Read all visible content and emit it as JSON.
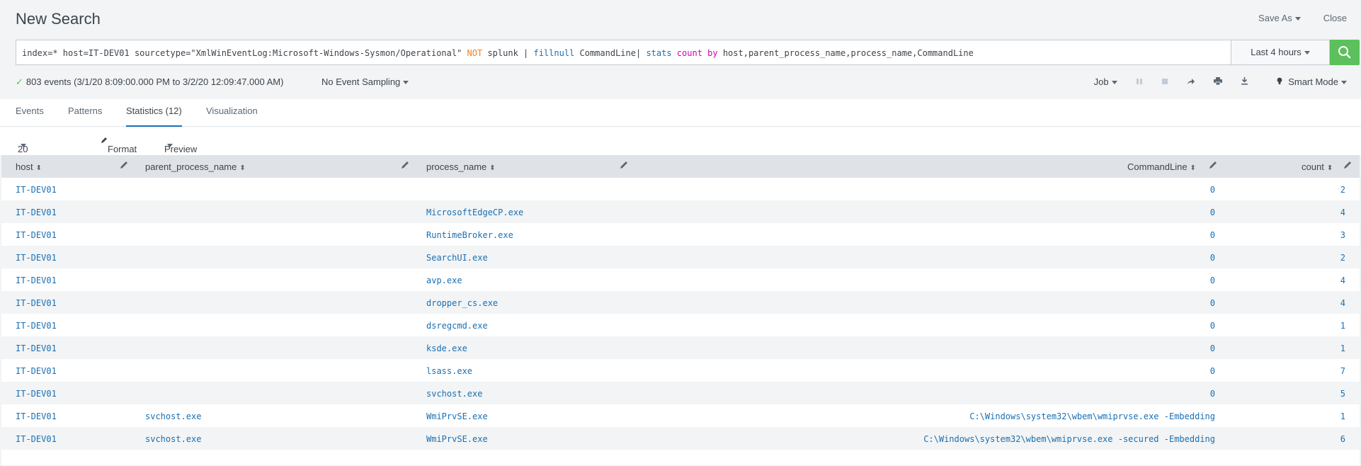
{
  "header": {
    "title": "New Search",
    "save_as": "Save As",
    "close": "Close"
  },
  "search": {
    "query_parts": [
      {
        "text": "index=* host=IT-DEV01 sourcetype=\"XmlWinEventLog:Microsoft-Windows-Sysmon/Operational\" ",
        "kind": "plain"
      },
      {
        "text": "NOT",
        "kind": "not"
      },
      {
        "text": " splunk | ",
        "kind": "plain"
      },
      {
        "text": "fillnull",
        "kind": "cmd"
      },
      {
        "text": " CommandLine| ",
        "kind": "plain"
      },
      {
        "text": "stats",
        "kind": "cmd"
      },
      {
        "text": " ",
        "kind": "plain"
      },
      {
        "text": "count",
        "kind": "fn"
      },
      {
        "text": " ",
        "kind": "plain"
      },
      {
        "text": "by",
        "kind": "fn"
      },
      {
        "text": " host,parent_process_name,process_name,CommandLine",
        "kind": "plain"
      }
    ],
    "time_range": "Last 4 hours",
    "search_icon": "search-icon"
  },
  "status": {
    "events_text": "803 events (3/1/20 8:09:00.000 PM to 3/2/20 12:09:47.000 AM)",
    "sampling": "No Event Sampling",
    "job": "Job",
    "mode": "Smart Mode"
  },
  "tabs": [
    {
      "label": "Events"
    },
    {
      "label": "Patterns"
    },
    {
      "label": "Statistics (12)"
    },
    {
      "label": "Visualization"
    }
  ],
  "toolbar": {
    "per_page": "20 Per Page",
    "format": "Format",
    "preview": "Preview"
  },
  "table": {
    "columns": [
      "host",
      "parent_process_name",
      "process_name",
      "CommandLine",
      "count"
    ],
    "rows": [
      [
        "IT-DEV01",
        "",
        "",
        "0",
        "2"
      ],
      [
        "IT-DEV01",
        "",
        "MicrosoftEdgeCP.exe",
        "0",
        "4"
      ],
      [
        "IT-DEV01",
        "",
        "RuntimeBroker.exe",
        "0",
        "3"
      ],
      [
        "IT-DEV01",
        "",
        "SearchUI.exe",
        "0",
        "2"
      ],
      [
        "IT-DEV01",
        "",
        "avp.exe",
        "0",
        "4"
      ],
      [
        "IT-DEV01",
        "",
        "dropper_cs.exe",
        "0",
        "4"
      ],
      [
        "IT-DEV01",
        "",
        "dsregcmd.exe",
        "0",
        "1"
      ],
      [
        "IT-DEV01",
        "",
        "ksde.exe",
        "0",
        "1"
      ],
      [
        "IT-DEV01",
        "",
        "lsass.exe",
        "0",
        "7"
      ],
      [
        "IT-DEV01",
        "",
        "svchost.exe",
        "0",
        "5"
      ],
      [
        "IT-DEV01",
        "svchost.exe",
        "WmiPrvSE.exe",
        "C:\\Windows\\system32\\wbem\\wmiprvse.exe -Embedding",
        "1"
      ],
      [
        "IT-DEV01",
        "svchost.exe",
        "WmiPrvSE.exe",
        "C:\\Windows\\system32\\wbem\\wmiprvse.exe -secured -Embedding",
        "6"
      ]
    ]
  },
  "colors": {
    "accent": "#1a6fb3",
    "search_button": "#5cc05c",
    "not_keyword": "#f58220",
    "function_keyword": "#d000b8"
  }
}
